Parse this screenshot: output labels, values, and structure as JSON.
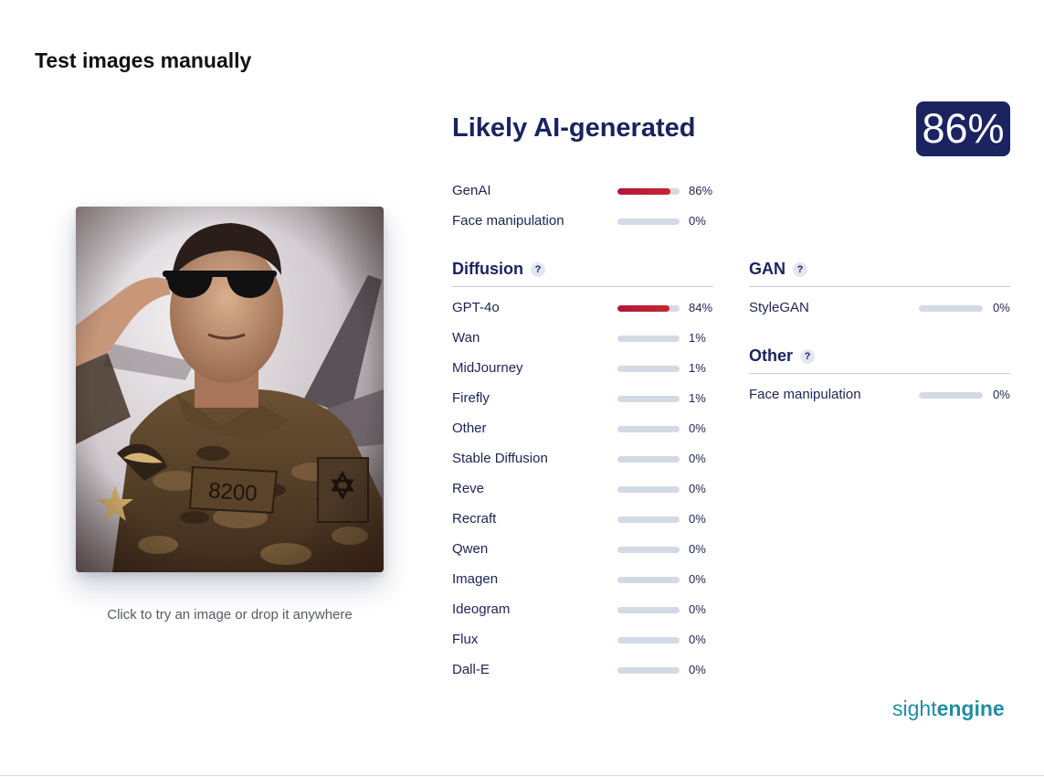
{
  "page": {
    "title": "Test images manually"
  },
  "upload": {
    "hint": "Click to try an image or drop it anywhere",
    "badge_text": "8200"
  },
  "result": {
    "verdict": "Likely AI-generated",
    "score_label": "86%",
    "summary": [
      {
        "label": "GenAI",
        "value": 86,
        "pct": "86%"
      },
      {
        "label": "Face manipulation",
        "value": 0,
        "pct": "0%"
      }
    ]
  },
  "diffusion": {
    "title": "Diffusion",
    "help": "?",
    "items": [
      {
        "label": "GPT-4o",
        "value": 84,
        "pct": "84%"
      },
      {
        "label": "Wan",
        "value": 1,
        "pct": "1%"
      },
      {
        "label": "MidJourney",
        "value": 1,
        "pct": "1%"
      },
      {
        "label": "Firefly",
        "value": 1,
        "pct": "1%"
      },
      {
        "label": "Other",
        "value": 0,
        "pct": "0%"
      },
      {
        "label": "Stable Diffusion",
        "value": 0,
        "pct": "0%"
      },
      {
        "label": "Reve",
        "value": 0,
        "pct": "0%"
      },
      {
        "label": "Recraft",
        "value": 0,
        "pct": "0%"
      },
      {
        "label": "Qwen",
        "value": 0,
        "pct": "0%"
      },
      {
        "label": "Imagen",
        "value": 0,
        "pct": "0%"
      },
      {
        "label": "Ideogram",
        "value": 0,
        "pct": "0%"
      },
      {
        "label": "Flux",
        "value": 0,
        "pct": "0%"
      },
      {
        "label": "Dall-E",
        "value": 0,
        "pct": "0%"
      }
    ]
  },
  "gan": {
    "title": "GAN",
    "help": "?",
    "items": [
      {
        "label": "StyleGAN",
        "value": 0,
        "pct": "0%"
      }
    ]
  },
  "other": {
    "title": "Other",
    "help": "?",
    "items": [
      {
        "label": "Face manipulation",
        "value": 0,
        "pct": "0%"
      }
    ]
  },
  "brand": {
    "light": "sight",
    "bold": "engine",
    "color": "#1f8ea3"
  },
  "colors": {
    "accent": "#1a2460",
    "bar_fill": "#b0163a",
    "bar_track": "#d3dae5"
  }
}
